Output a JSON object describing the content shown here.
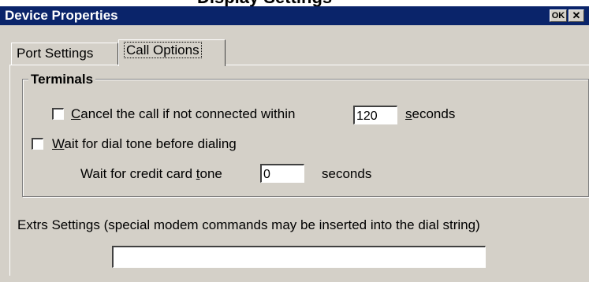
{
  "page_heading_fragment": "Display Settings",
  "window": {
    "title": "Device Properties",
    "ok_button": "OK",
    "close_button": "✕"
  },
  "tabs": [
    {
      "label": "Port Settings",
      "selected": false
    },
    {
      "label": "Call Options",
      "selected": true
    }
  ],
  "terminals": {
    "group_label": "Terminals",
    "cancel_call": {
      "checked": false,
      "label_prefix": "",
      "label_mnemonic": "C",
      "label_rest": "ancel the call if not connected within",
      "value": "120",
      "unit_mnemonic": "s",
      "unit_rest": "econds"
    },
    "wait_dial_tone": {
      "checked": false,
      "label_mnemonic": "W",
      "label_rest": "ait for dial tone before dialing"
    },
    "credit_card": {
      "label_prefix": "Wait for credit card ",
      "label_mnemonic": "t",
      "label_rest": "one",
      "value": "0",
      "unit": "seconds"
    }
  },
  "extra_settings": {
    "label": "Extrs Settings (special modem commands may be inserted into the dial string)",
    "value": ""
  },
  "colors": {
    "titlebar": "#0a246a",
    "face": "#d4d0c8"
  }
}
